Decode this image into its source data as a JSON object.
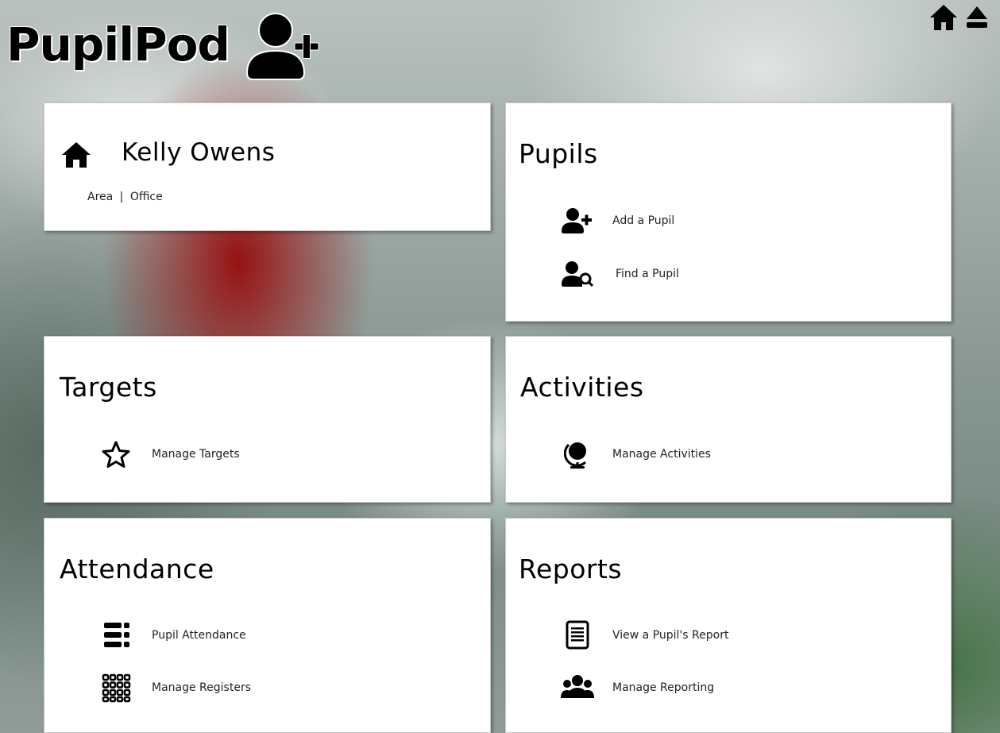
{
  "header": {
    "logo_text": "PupilPod",
    "logo_icon": "add-user-icon",
    "top_icons": [
      "home-icon",
      "eject-logout-icon"
    ]
  },
  "profile": {
    "name": "Kelly Owens",
    "area_label": "Area",
    "separator": "|",
    "area_value": "Office",
    "icon": "home-icon"
  },
  "pupils": {
    "title": "Pupils",
    "items": [
      {
        "label": "Add a Pupil",
        "icon": "add-user-icon"
      },
      {
        "label": "Find a Pupil",
        "icon": "find-user-icon"
      }
    ]
  },
  "targets": {
    "title": "Targets",
    "items": [
      {
        "label": "Manage Targets",
        "icon": "star-icon"
      }
    ]
  },
  "activities": {
    "title": "Activities",
    "items": [
      {
        "label": "Manage Activities",
        "icon": "globe-icon"
      }
    ]
  },
  "attendance": {
    "title": "Attendance",
    "items": [
      {
        "label": "Pupil Attendance",
        "icon": "list-icon"
      },
      {
        "label": "Manage Registers",
        "icon": "grid-icon"
      }
    ]
  },
  "reports": {
    "title": "Reports",
    "items": [
      {
        "label": "View a Pupil's Report",
        "icon": "document-icon"
      },
      {
        "label": "Manage Reporting",
        "icon": "users-group-icon"
      }
    ]
  }
}
